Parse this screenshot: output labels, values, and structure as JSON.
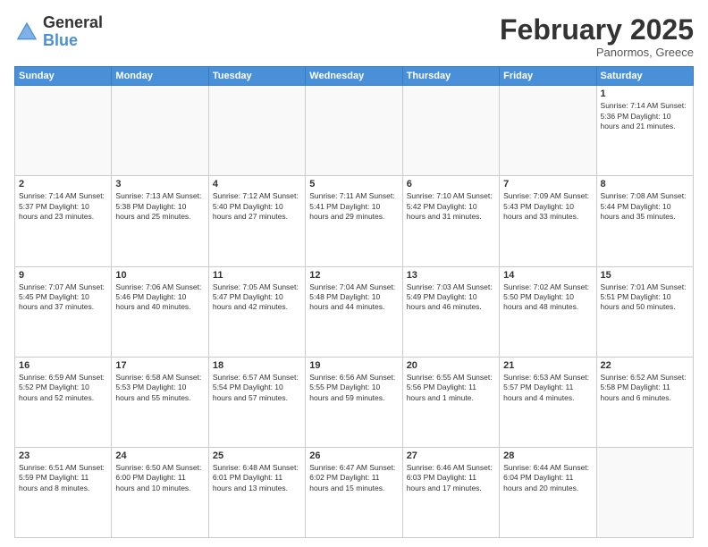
{
  "logo": {
    "general": "General",
    "blue": "Blue"
  },
  "header": {
    "month": "February 2025",
    "location": "Panormos, Greece"
  },
  "weekdays": [
    "Sunday",
    "Monday",
    "Tuesday",
    "Wednesday",
    "Thursday",
    "Friday",
    "Saturday"
  ],
  "weeks": [
    [
      {
        "day": "",
        "info": ""
      },
      {
        "day": "",
        "info": ""
      },
      {
        "day": "",
        "info": ""
      },
      {
        "day": "",
        "info": ""
      },
      {
        "day": "",
        "info": ""
      },
      {
        "day": "",
        "info": ""
      },
      {
        "day": "1",
        "info": "Sunrise: 7:14 AM\nSunset: 5:36 PM\nDaylight: 10 hours\nand 21 minutes."
      }
    ],
    [
      {
        "day": "2",
        "info": "Sunrise: 7:14 AM\nSunset: 5:37 PM\nDaylight: 10 hours\nand 23 minutes."
      },
      {
        "day": "3",
        "info": "Sunrise: 7:13 AM\nSunset: 5:38 PM\nDaylight: 10 hours\nand 25 minutes."
      },
      {
        "day": "4",
        "info": "Sunrise: 7:12 AM\nSunset: 5:40 PM\nDaylight: 10 hours\nand 27 minutes."
      },
      {
        "day": "5",
        "info": "Sunrise: 7:11 AM\nSunset: 5:41 PM\nDaylight: 10 hours\nand 29 minutes."
      },
      {
        "day": "6",
        "info": "Sunrise: 7:10 AM\nSunset: 5:42 PM\nDaylight: 10 hours\nand 31 minutes."
      },
      {
        "day": "7",
        "info": "Sunrise: 7:09 AM\nSunset: 5:43 PM\nDaylight: 10 hours\nand 33 minutes."
      },
      {
        "day": "8",
        "info": "Sunrise: 7:08 AM\nSunset: 5:44 PM\nDaylight: 10 hours\nand 35 minutes."
      }
    ],
    [
      {
        "day": "9",
        "info": "Sunrise: 7:07 AM\nSunset: 5:45 PM\nDaylight: 10 hours\nand 37 minutes."
      },
      {
        "day": "10",
        "info": "Sunrise: 7:06 AM\nSunset: 5:46 PM\nDaylight: 10 hours\nand 40 minutes."
      },
      {
        "day": "11",
        "info": "Sunrise: 7:05 AM\nSunset: 5:47 PM\nDaylight: 10 hours\nand 42 minutes."
      },
      {
        "day": "12",
        "info": "Sunrise: 7:04 AM\nSunset: 5:48 PM\nDaylight: 10 hours\nand 44 minutes."
      },
      {
        "day": "13",
        "info": "Sunrise: 7:03 AM\nSunset: 5:49 PM\nDaylight: 10 hours\nand 46 minutes."
      },
      {
        "day": "14",
        "info": "Sunrise: 7:02 AM\nSunset: 5:50 PM\nDaylight: 10 hours\nand 48 minutes."
      },
      {
        "day": "15",
        "info": "Sunrise: 7:01 AM\nSunset: 5:51 PM\nDaylight: 10 hours\nand 50 minutes."
      }
    ],
    [
      {
        "day": "16",
        "info": "Sunrise: 6:59 AM\nSunset: 5:52 PM\nDaylight: 10 hours\nand 52 minutes."
      },
      {
        "day": "17",
        "info": "Sunrise: 6:58 AM\nSunset: 5:53 PM\nDaylight: 10 hours\nand 55 minutes."
      },
      {
        "day": "18",
        "info": "Sunrise: 6:57 AM\nSunset: 5:54 PM\nDaylight: 10 hours\nand 57 minutes."
      },
      {
        "day": "19",
        "info": "Sunrise: 6:56 AM\nSunset: 5:55 PM\nDaylight: 10 hours\nand 59 minutes."
      },
      {
        "day": "20",
        "info": "Sunrise: 6:55 AM\nSunset: 5:56 PM\nDaylight: 11 hours\nand 1 minute."
      },
      {
        "day": "21",
        "info": "Sunrise: 6:53 AM\nSunset: 5:57 PM\nDaylight: 11 hours\nand 4 minutes."
      },
      {
        "day": "22",
        "info": "Sunrise: 6:52 AM\nSunset: 5:58 PM\nDaylight: 11 hours\nand 6 minutes."
      }
    ],
    [
      {
        "day": "23",
        "info": "Sunrise: 6:51 AM\nSunset: 5:59 PM\nDaylight: 11 hours\nand 8 minutes."
      },
      {
        "day": "24",
        "info": "Sunrise: 6:50 AM\nSunset: 6:00 PM\nDaylight: 11 hours\nand 10 minutes."
      },
      {
        "day": "25",
        "info": "Sunrise: 6:48 AM\nSunset: 6:01 PM\nDaylight: 11 hours\nand 13 minutes."
      },
      {
        "day": "26",
        "info": "Sunrise: 6:47 AM\nSunset: 6:02 PM\nDaylight: 11 hours\nand 15 minutes."
      },
      {
        "day": "27",
        "info": "Sunrise: 6:46 AM\nSunset: 6:03 PM\nDaylight: 11 hours\nand 17 minutes."
      },
      {
        "day": "28",
        "info": "Sunrise: 6:44 AM\nSunset: 6:04 PM\nDaylight: 11 hours\nand 20 minutes."
      },
      {
        "day": "",
        "info": ""
      }
    ]
  ]
}
